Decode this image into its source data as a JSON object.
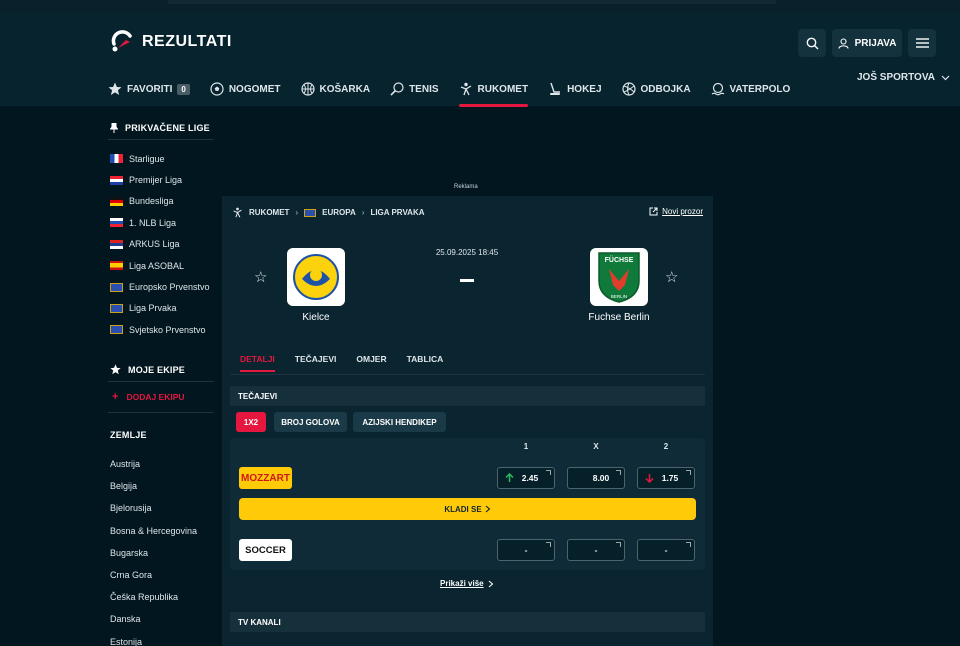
{
  "brand": {
    "name": "REZULTATI"
  },
  "header": {
    "login_label": "PRIJAVA",
    "search_icon": "search-icon",
    "menu_icon": "hamburger-icon"
  },
  "nav": {
    "items": [
      {
        "label": "FAVORITI",
        "icon": "star-icon",
        "badge": "0"
      },
      {
        "label": "NOGOMET",
        "icon": "football-icon"
      },
      {
        "label": "KOŠARKA",
        "icon": "basketball-icon"
      },
      {
        "label": "TENIS",
        "icon": "tennis-icon"
      },
      {
        "label": "RUKOMET",
        "icon": "handball-icon",
        "active": true
      },
      {
        "label": "HOKEJ",
        "icon": "hockey-icon"
      },
      {
        "label": "ODBOJKA",
        "icon": "volleyball-icon"
      },
      {
        "label": "VATERPOLO",
        "icon": "waterpolo-icon"
      }
    ],
    "more_label": "JOŠ SPORTOVA"
  },
  "sidebar": {
    "pinned_title": "PRIKVAČENE LIGE",
    "pinned": [
      {
        "label": "Starligue",
        "flag": "fr"
      },
      {
        "label": "Premijer Liga",
        "flag": "hr"
      },
      {
        "label": "Bundesliga",
        "flag": "de"
      },
      {
        "label": "1. NLB Liga",
        "flag": "si"
      },
      {
        "label": "ARKUS Liga",
        "flag": "rs"
      },
      {
        "label": "Liga ASOBAL",
        "flag": "es"
      },
      {
        "label": "Europsko Prvenstvo",
        "flag": "eu"
      },
      {
        "label": "Liga Prvaka",
        "flag": "eu"
      },
      {
        "label": "Svjetsko Prvenstvo",
        "flag": "world"
      }
    ],
    "my_teams_title": "MOJE EKIPE",
    "add_team_label": "DODAJ EKIPU",
    "countries_title": "ZEMLJE",
    "countries": [
      "Austrija",
      "Belgija",
      "Bjelorusija",
      "Bosna & Hercegovina",
      "Bugarska",
      "Crna Gora",
      "Češka Republika",
      "Danska",
      "Estonija"
    ]
  },
  "ad": {
    "label": "Reklama"
  },
  "match": {
    "breadcrumb": [
      "RUKOMET",
      "EUROPA",
      "LIGA PRVAKA"
    ],
    "new_window_label": "Novi prozor",
    "datetime": "25.09.2025 18:45",
    "score": "-",
    "home": {
      "name": "Kielce"
    },
    "away": {
      "name": "Fuchse Berlin",
      "logo_text": "FÜCHSE",
      "logo_sub": "BERLIN"
    },
    "tabs": [
      "DETALJI",
      "TEČAJEVI",
      "OMJER",
      "TABLICA"
    ],
    "active_tab": "DETALJI"
  },
  "odds": {
    "section_title": "TEČAJEVI",
    "markets": [
      "1X2",
      "BROJ GOLOVA",
      "AZIJSKI HENDIKEP"
    ],
    "columns": [
      "1",
      "X",
      "2"
    ],
    "bookmakers": [
      {
        "name": "MOZZART",
        "odds": [
          "2.45",
          "8.00",
          "1.75"
        ],
        "trend": [
          "up",
          "none",
          "down"
        ]
      },
      {
        "name": "SOCCER",
        "odds": [
          "-",
          "-",
          "-"
        ]
      }
    ],
    "bet_label": "KLADI SE",
    "show_more_label": "Prikaži više"
  },
  "tv": {
    "section_title": "TV KANALI"
  },
  "colors": {
    "accent": "#e5173f",
    "bet_button": "#ffcb09",
    "background": "#01161f"
  }
}
